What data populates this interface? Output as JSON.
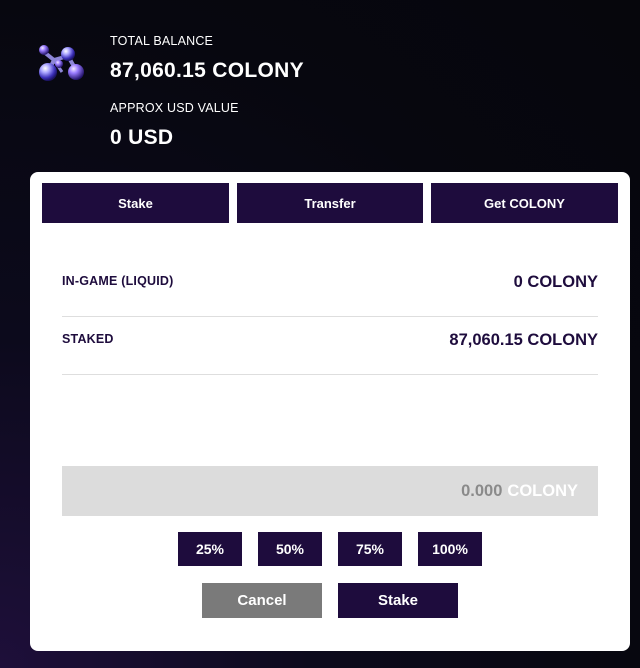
{
  "balance": {
    "total_label": "TOTAL BALANCE",
    "total_value": "87,060.15 COLONY",
    "usd_label": "APPROX USD VALUE",
    "usd_value": "0 USD",
    "logo_icon": "colony-molecule-icon"
  },
  "tabs": [
    {
      "label": "Stake"
    },
    {
      "label": "Transfer"
    },
    {
      "label": "Get COLONY"
    }
  ],
  "rows": [
    {
      "label": "IN-GAME (LIQUID)",
      "value": "0 COLONY"
    },
    {
      "label": "STAKED",
      "value": "87,060.15 COLONY"
    }
  ],
  "amount_input": {
    "value": "0.000",
    "unit": "COLONY"
  },
  "percent_buttons": [
    "25%",
    "50%",
    "75%",
    "100%"
  ],
  "actions": {
    "cancel_label": "Cancel",
    "stake_label": "Stake"
  },
  "colors": {
    "accent": "#1e0c3d",
    "cancel": "#7a7a7a",
    "input_bg": "#dcdcdc"
  }
}
